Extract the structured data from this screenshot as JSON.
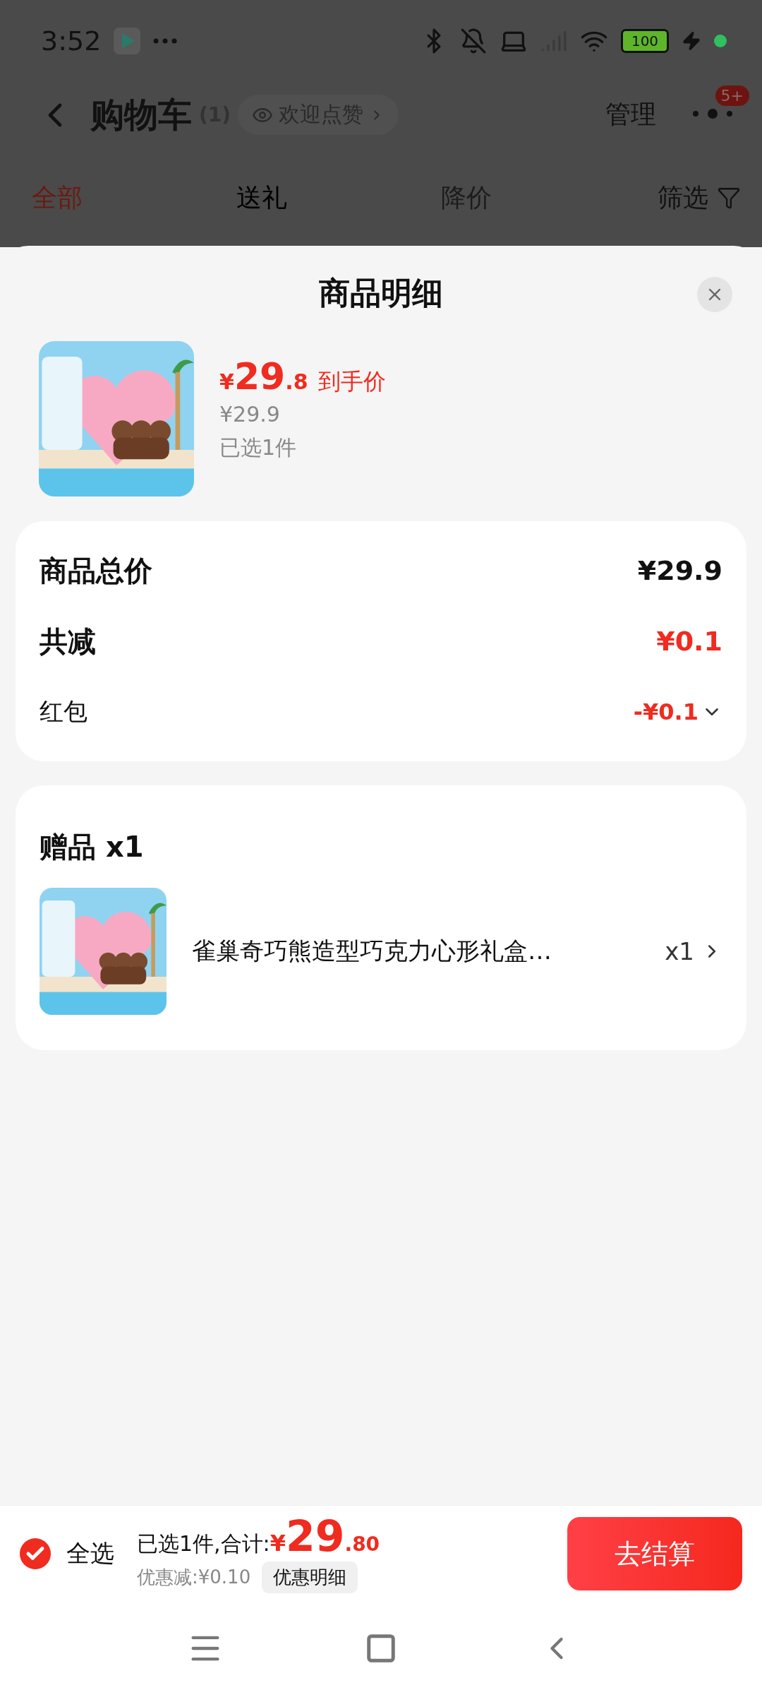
{
  "status_bar": {
    "time": "3:52",
    "battery": "100"
  },
  "header": {
    "title": "购物车",
    "count": "(1)",
    "like_chip": "欢迎点赞",
    "manage": "管理",
    "badge": "5+"
  },
  "tabs": [
    {
      "label": "全部",
      "selected": true,
      "disabled": false
    },
    {
      "label": "送礼",
      "selected": false,
      "disabled": false
    },
    {
      "label": "降价",
      "selected": false,
      "disabled": true
    }
  ],
  "filter": "筛选",
  "sheet": {
    "title": "商品明细",
    "product": {
      "currency": "¥",
      "price_int": "29",
      "price_dec": ".8",
      "price_label": "到手价",
      "original_price": "¥29.9",
      "selected_count": "已选1件"
    },
    "summary": [
      {
        "kind": "total",
        "label": "商品总价",
        "value": "¥29.9"
      },
      {
        "kind": "discount",
        "label": "共减",
        "value": "¥0.1"
      },
      {
        "kind": "coupon",
        "label": "红包",
        "value": "-¥0.1"
      }
    ],
    "gift": {
      "title": "赠品 x1",
      "items": [
        {
          "name": "雀巢奇巧熊造型巧克力心形礼盒…",
          "quantity": "x1"
        }
      ]
    }
  },
  "bottom_bar": {
    "select_all": {
      "label": "全选",
      "checked": true
    },
    "summary": "已选1件,合计:",
    "currency": "¥",
    "total_int": "29",
    "total_dec": ".80",
    "discount": "优惠减:¥0.10",
    "detail_button": "优惠明细",
    "checkout": "去结算"
  }
}
